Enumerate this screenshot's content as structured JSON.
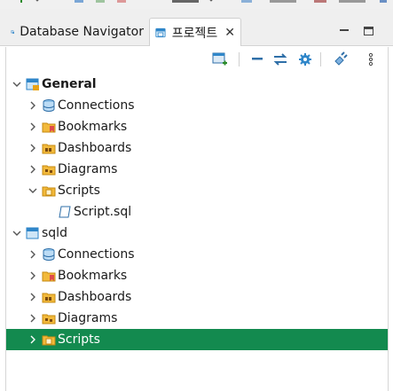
{
  "tabs": {
    "database_navigator": "Database Navigator",
    "project": "프로젝트",
    "close_glyph": "✕"
  },
  "colors": {
    "selection": "#138a4f",
    "folder": "#e8a317",
    "project_blue": "#2f86c9"
  },
  "toolbar": {
    "icons": [
      "new-resource-icon",
      "collapse-all-icon",
      "link-with-editor-icon",
      "configure-icon",
      "connect-icon",
      "view-menu-icon"
    ]
  },
  "tree": {
    "general": {
      "label": "General",
      "connections": "Connections",
      "bookmarks": "Bookmarks",
      "dashboards": "Dashboards",
      "diagrams": "Diagrams",
      "scripts": "Scripts",
      "script_file": "Script.sql"
    },
    "sqld": {
      "label": "sqld",
      "connections": "Connections",
      "bookmarks": "Bookmarks",
      "dashboards": "Dashboards",
      "diagrams": "Diagrams",
      "scripts": "Scripts"
    }
  }
}
